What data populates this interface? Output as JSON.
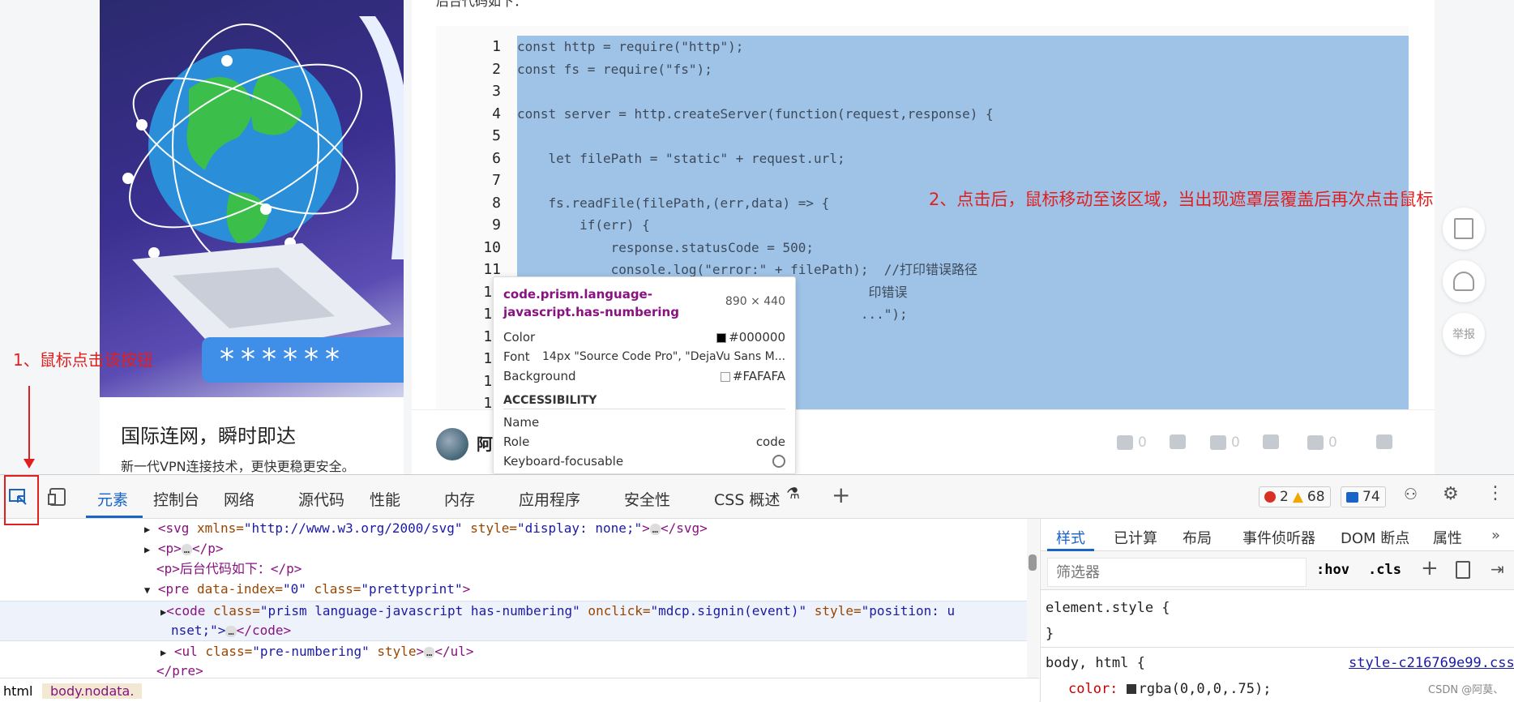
{
  "article": {
    "top_text": "后台代码如下：",
    "author_name": "阿"
  },
  "ad": {
    "title": "国际连网，瞬时即达",
    "subtitle": "新一代VPN连接技术，更快更稳更安全。",
    "password_stars": "******"
  },
  "code": {
    "line_numbers": [
      "1",
      "2",
      "3",
      "4",
      "5",
      "6",
      "7",
      "8",
      "9",
      "10",
      "11",
      "12",
      "13",
      "14",
      "15",
      "16",
      "17"
    ],
    "lines": [
      "const http = require(\"http\");",
      "const fs = require(\"fs\");",
      "",
      "const server = http.createServer(function(request,response) {",
      "",
      "    let filePath = \"static\" + request.url;",
      "",
      "    fs.readFile(filePath,(err,data) => {",
      "        if(err) {",
      "            response.statusCode = 500;",
      "            console.log(\"error:\" + filePath);  //打印错误路径",
      "                                             印错误",
      "                                            ...\");"
    ]
  },
  "actions": {
    "like_count": "0",
    "dislike_count": "0",
    "collect_count": "0",
    "comment_count": "0"
  },
  "float_buttons": {
    "report": "举报"
  },
  "annotations": {
    "step1": "1、鼠标点击该按钮",
    "step2": "2、点击后，鼠标移动至该区域，当出现遮罩层覆盖后再次点击鼠标"
  },
  "tooltip": {
    "selector": "code.prism.language-javascript.has-numbering",
    "size": "890 × 440",
    "color_label": "Color",
    "color_value": "#000000",
    "font_label": "Font",
    "font_value": "14px \"Source Code Pro\", \"DejaVu Sans M...",
    "background_label": "Background",
    "background_value": "#FAFAFA",
    "section": "ACCESSIBILITY",
    "name_label": "Name",
    "role_label": "Role",
    "role_value": "code",
    "focusable_label": "Keyboard-focusable"
  },
  "devtools": {
    "tabs": [
      "元素",
      "控制台",
      "网络",
      "源代码",
      "性能",
      "内存",
      "应用程序",
      "安全性",
      "CSS 概述"
    ],
    "errors": "2",
    "warnings": "68",
    "messages": "74",
    "style_tabs": [
      "样式",
      "已计算",
      "布局",
      "事件侦听器",
      "DOM 断点",
      "属性"
    ],
    "filter_placeholder": "筛选器",
    "hov": ":hov",
    "cls": ".cls",
    "element_style": "element.style {",
    "close_brace": "}",
    "rule_selector": "body, html {",
    "rule_source": "style-c216769e99.css",
    "rule_prop": "color:",
    "rule_val": "rgba(0,0,0,.75);",
    "crumbs": [
      "html",
      "body.nodata."
    ]
  },
  "dom": {
    "l1_tag": "<svg",
    "l1_attrs": " xmlns=",
    "l1_v": "\"http://www.w3.org/2000/svg\"",
    "l1_a2": " style=",
    "l1_v2": "\"display: none;\"",
    "l1_end": "</svg>",
    "l2": "<p>",
    "l2_end": "</p>",
    "l3": "<p>后台代码如下：</p>",
    "l4_tag": "<pre",
    "l4_a1": " data-index=",
    "l4_v1": "\"0\"",
    "l4_a2": " class=",
    "l4_v2": "\"prettyprint\"",
    "l5_tag": "<code",
    "l5_a1": " class=",
    "l5_v1": "\"prism language-javascript has-numbering\"",
    "l5_a2": " onclick=",
    "l5_v2": "\"mdcp.signin(event)\"",
    "l5_a3": " style=",
    "l5_v3": "\"position: u",
    "l5b": "nset;\">",
    "l5b_end": "</code>",
    "l6_tag": "<ul",
    "l6_a1": " class=",
    "l6_v1": "\"pre-numbering\"",
    "l6_a2": " style",
    "l6_end": "</ul>",
    "l7": "</pre>"
  },
  "watermark": "CSDN @阿莫、"
}
